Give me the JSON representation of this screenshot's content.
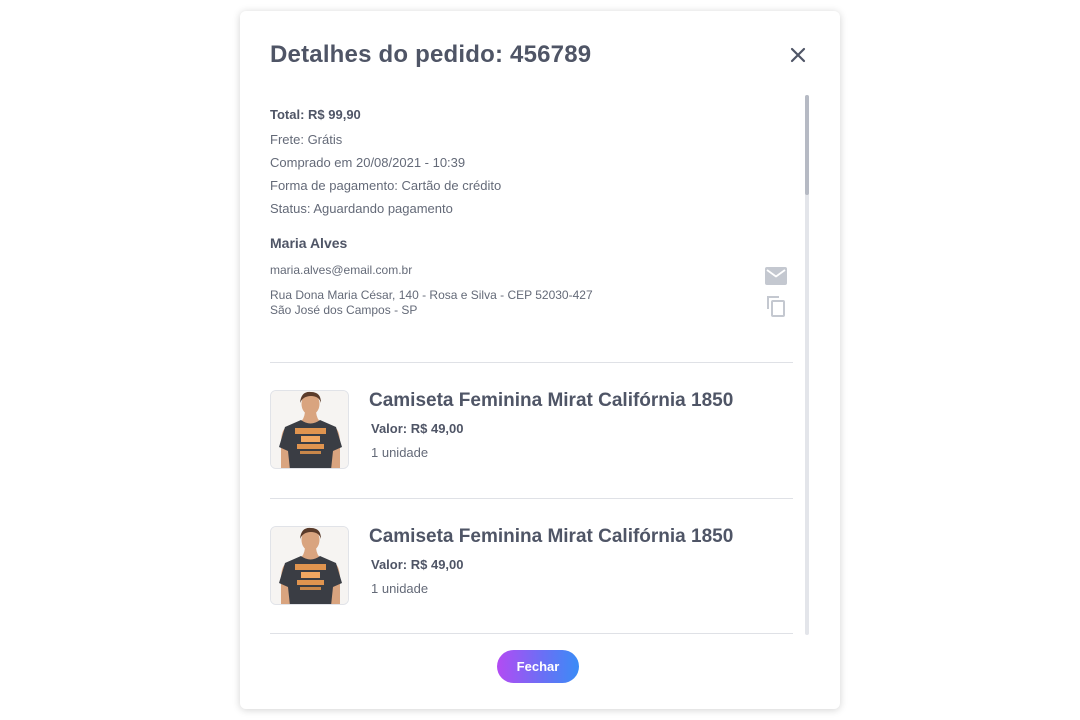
{
  "modal": {
    "title": "Detalhes do pedido: 456789",
    "close_label": "Fechar"
  },
  "summary": {
    "total": "Total: R$ 99,90",
    "shipping": "Frete: Grátis",
    "purchased_at": "Comprado em 20/08/2021 - 10:39",
    "payment_method": "Forma de pagamento: Cartão de crédito",
    "status": "Status: Aguardando pagamento"
  },
  "customer": {
    "name": "Maria Alves",
    "email": "maria.alves@email.com.br",
    "address_line1": "Rua Dona Maria César, 140 - Rosa e Silva - CEP 52030-427",
    "address_line2": "São José dos Campos - SP"
  },
  "products": [
    {
      "name": "Camiseta Feminina Mirat Califórnia 1850",
      "price": "Valor: R$ 49,00",
      "quantity": "1 unidade"
    },
    {
      "name": "Camiseta Feminina Mirat Califórnia 1850",
      "price": "Valor: R$ 49,00",
      "quantity": "1 unidade"
    }
  ],
  "colors": {
    "title": "#4f5566",
    "text": "#646a78",
    "button_gradient_start": "#b34bf3",
    "button_gradient_end": "#3a8cf6"
  },
  "icons": {
    "close": "close-icon",
    "mail": "mail-icon",
    "copy": "copy-icon"
  }
}
